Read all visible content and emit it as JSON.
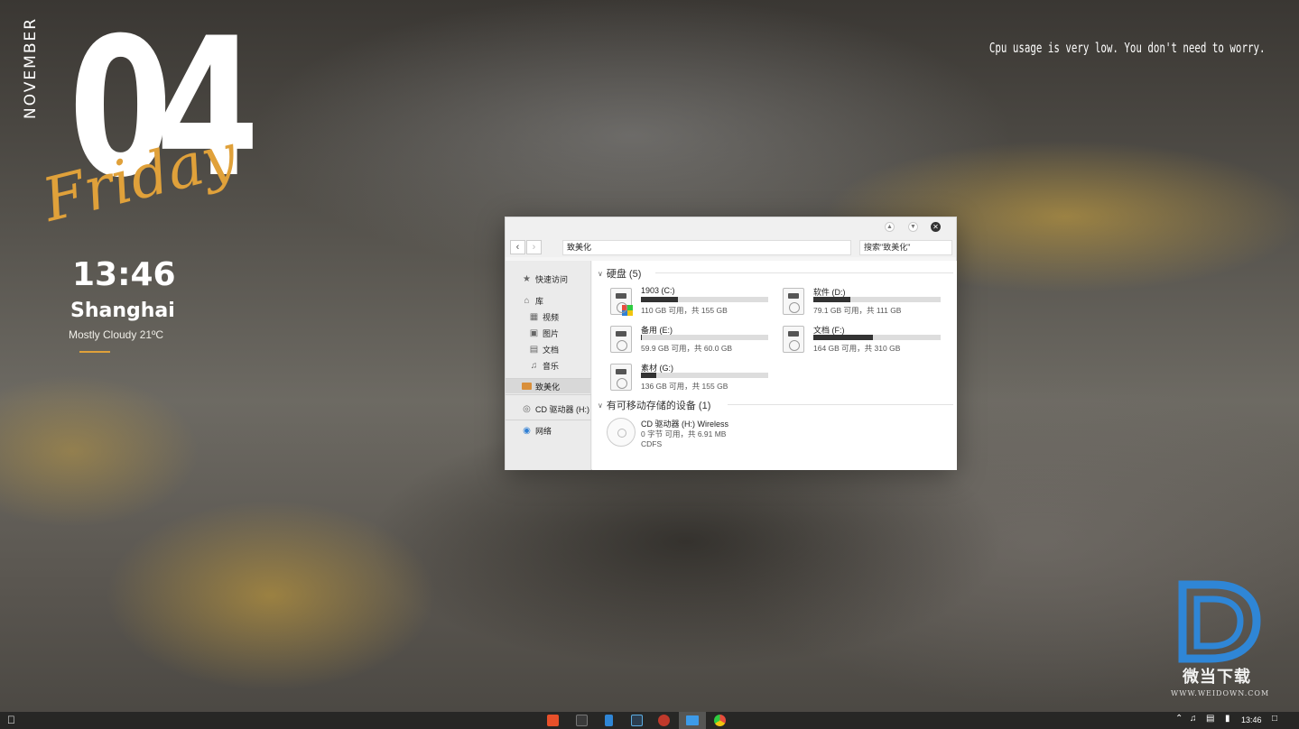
{
  "widget": {
    "month": "NOVEMBER",
    "day": "04",
    "weekday": "Friday",
    "time": "13:46",
    "city": "Shanghai",
    "weather": "Mostly Cloudy 21ºC",
    "accent_color": "#e0a13a"
  },
  "cpu_message": "Cpu usage is very low. You don't need to worry.",
  "explorer": {
    "titlebar": {
      "minimize_icon": "chevron-up-icon",
      "maximize_icon": "chevron-down-icon",
      "close_icon": "close-icon"
    },
    "address": "致美化",
    "search_placeholder": "搜索\"致美化\"",
    "sidebar": {
      "quick_access": "快速访问",
      "library": "库",
      "videos": "视频",
      "pictures": "图片",
      "documents": "文档",
      "music": "音乐",
      "zhimeihua": "致美化",
      "cd_drive": "CD 驱动器 (H:)",
      "network": "网络"
    },
    "hard_disks": {
      "header": "硬盘 (5)",
      "drives": [
        {
          "name": "1903 (C:)",
          "free": "110 GB 可用，共 155 GB",
          "used_fraction": 0.29
        },
        {
          "name": "软件 (D:)",
          "free": "79.1 GB 可用，共 111 GB",
          "used_fraction": 0.29
        },
        {
          "name": "备用 (E:)",
          "free": "59.9 GB 可用，共 60.0 GB",
          "used_fraction": 0.01
        },
        {
          "name": "文档 (F:)",
          "free": "164 GB 可用，共 310 GB",
          "used_fraction": 0.47
        },
        {
          "name": "素材 (G:)",
          "free": "136 GB 可用，共 155 GB",
          "used_fraction": 0.12
        }
      ]
    },
    "removable": {
      "header": "有可移动存储的设备 (1)",
      "device": {
        "name": "CD 驱动器 (H:) Wireless",
        "free": "0 字节 可用，共 6.91 MB",
        "fs": "CDFS"
      }
    }
  },
  "watermark": {
    "brand": "微当下载",
    "url": "WWW.WEIDOWN.COM"
  },
  "taskbar": {
    "apple_icon": "apple-icon",
    "apps": [
      "office-icon",
      "text-editor-icon",
      "phone-icon",
      "terminal-icon",
      "record-icon",
      "file-explorer-icon",
      "chrome-icon"
    ],
    "clock": "13:46"
  }
}
